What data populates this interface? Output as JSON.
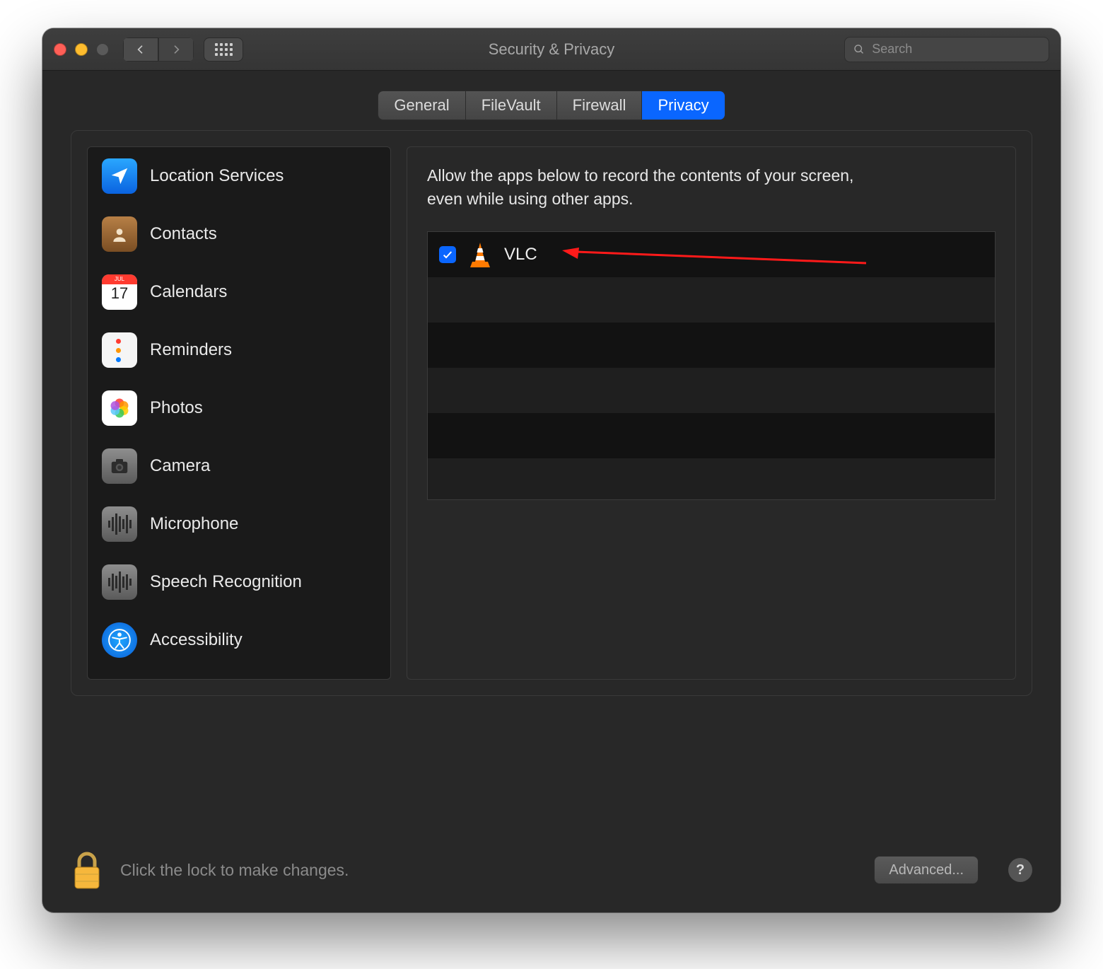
{
  "window": {
    "title": "Security & Privacy"
  },
  "search": {
    "placeholder": "Search"
  },
  "tabs": {
    "items": [
      {
        "label": "General"
      },
      {
        "label": "FileVault"
      },
      {
        "label": "Firewall"
      },
      {
        "label": "Privacy"
      }
    ],
    "active_index": 3
  },
  "sidebar": {
    "items": [
      {
        "icon": "location",
        "label": "Location Services"
      },
      {
        "icon": "contacts",
        "label": "Contacts"
      },
      {
        "icon": "calendars",
        "label": "Calendars"
      },
      {
        "icon": "reminders",
        "label": "Reminders"
      },
      {
        "icon": "photos",
        "label": "Photos"
      },
      {
        "icon": "camera",
        "label": "Camera"
      },
      {
        "icon": "microphone",
        "label": "Microphone"
      },
      {
        "icon": "speech",
        "label": "Speech Recognition"
      },
      {
        "icon": "accessibility",
        "label": "Accessibility"
      }
    ]
  },
  "right": {
    "description": "Allow the apps below to record the contents of your screen, even while using other apps.",
    "apps": [
      {
        "name": "VLC",
        "checked": true,
        "icon": "vlc"
      }
    ]
  },
  "footer": {
    "lock_text": "Click the lock to make changes.",
    "advanced_label": "Advanced...",
    "help_label": "?"
  },
  "annotation": {
    "arrow_points_to": "VLC",
    "color": "#ff1a1a"
  }
}
